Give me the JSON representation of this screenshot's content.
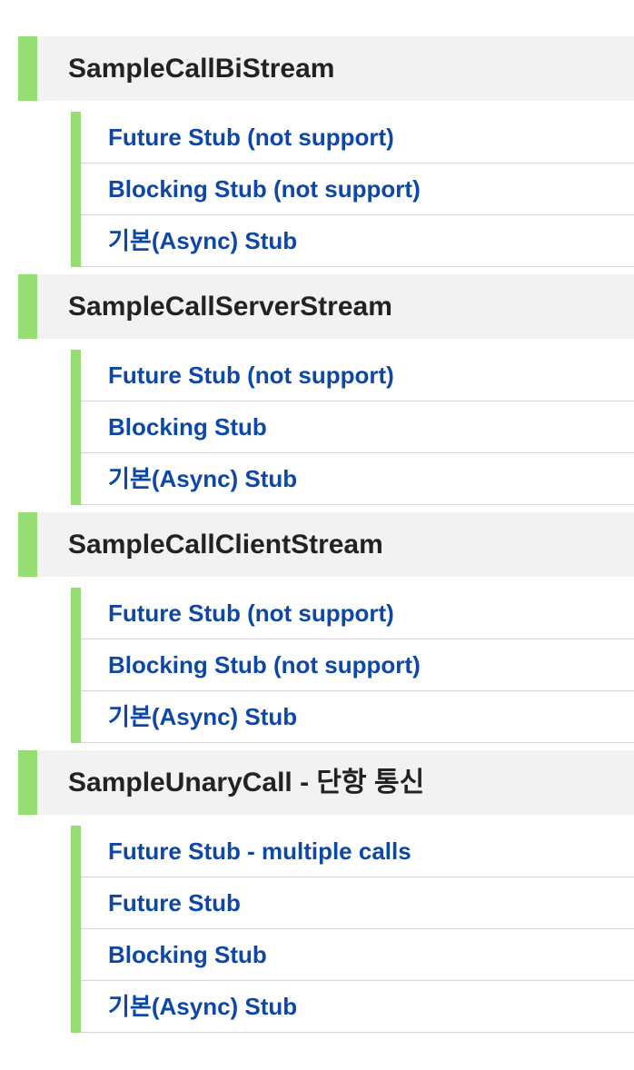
{
  "sections": [
    {
      "title": "SampleCallBiStream",
      "items": [
        "Future Stub (not support)",
        "Blocking Stub (not support)",
        "기본(Async) Stub"
      ]
    },
    {
      "title": "SampleCallServerStream",
      "items": [
        "Future Stub (not support)",
        "Blocking Stub",
        "기본(Async) Stub"
      ]
    },
    {
      "title": "SampleCallClientStream",
      "items": [
        "Future Stub (not support)",
        "Blocking Stub (not support)",
        "기본(Async) Stub"
      ]
    },
    {
      "title": "SampleUnaryCall - 단항 통신",
      "items": [
        "Future Stub - multiple calls",
        "Future Stub",
        "Blocking Stub",
        "기본(Async) Stub"
      ]
    }
  ],
  "colors": {
    "accent_green": "#95de74",
    "link_blue": "#0d47a8",
    "header_bg": "#f2f2f2",
    "title_text": "#222222",
    "divider": "#d3d3d3"
  }
}
